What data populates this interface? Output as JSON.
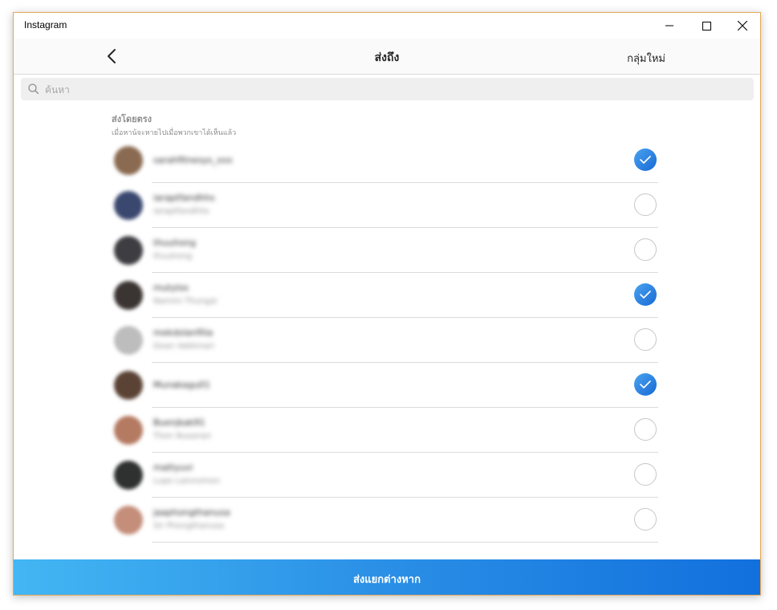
{
  "window": {
    "title": "Instagram"
  },
  "header": {
    "title": "ส่งถึง",
    "new_group": "กลุ่มใหม่"
  },
  "search": {
    "placeholder": "ค้นหา"
  },
  "section": {
    "title": "ส่งโดยตรง",
    "subtitle": "เมื่อหาน้จะหายไปเมื่อพวกเขาได้เห็นแล้ว"
  },
  "contacts": [
    {
      "username": "sarahfitnesys_xxx",
      "fullname": "",
      "checked": true,
      "avatar_color": "#8a6a50"
    },
    {
      "username": "iaraptfandhhs",
      "fullname": "iaraptfandhhs",
      "checked": false,
      "avatar_color": "#3a4870"
    },
    {
      "username": "thuuhong",
      "fullname": "thuuhong",
      "checked": false,
      "avatar_color": "#3d3d42"
    },
    {
      "username": "mutylos",
      "fullname": "Nammi Thungai",
      "checked": true,
      "avatar_color": "#3a3432"
    },
    {
      "username": "mekdolanfilia",
      "fullname": "Dean Vakkmari",
      "checked": false,
      "avatar_color": "#bdbdbd"
    },
    {
      "username": "Munakagu01",
      "fullname": "",
      "checked": true,
      "avatar_color": "#5a4234"
    },
    {
      "username": "Buenjkak91",
      "fullname": "Then Nusanan",
      "checked": false,
      "avatar_color": "#b57a62"
    },
    {
      "username": "mattyuvi",
      "fullname": "Lupe Lainnomen",
      "checked": false,
      "avatar_color": "#2f3030"
    },
    {
      "username": "jaaphongthanusa",
      "fullname": "Sir Phongthanusa",
      "checked": false,
      "avatar_color": "#c48e7a"
    }
  ],
  "footer": {
    "send_label": "ส่งแยกต่างหาก"
  }
}
